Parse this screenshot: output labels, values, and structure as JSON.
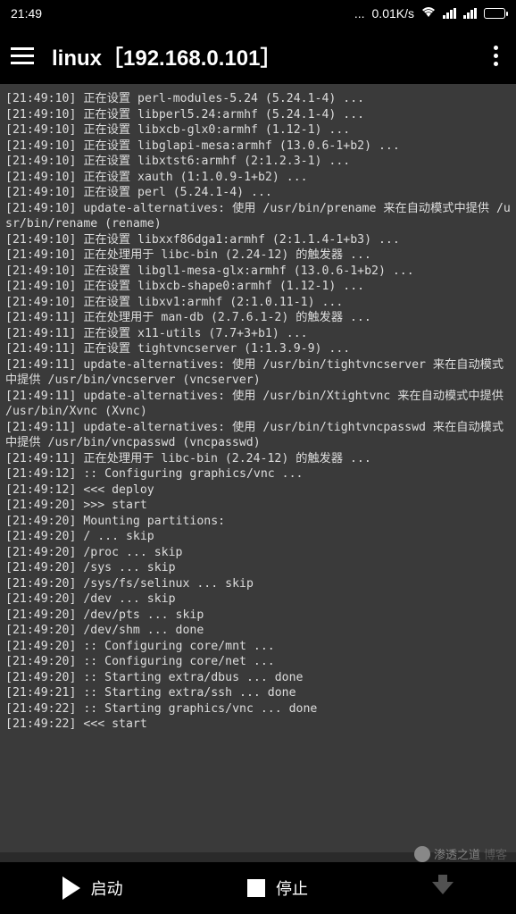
{
  "status": {
    "time": "21:49",
    "speed": "0.01K/s"
  },
  "header": {
    "title": "linux［192.168.0.101］"
  },
  "terminal": {
    "lines": [
      "[21:49:10] 正在设置 perl-modules-5.24 (5.24.1-4) ...",
      "[21:49:10] 正在设置 libperl5.24:armhf (5.24.1-4) ...",
      "[21:49:10] 正在设置 libxcb-glx0:armhf (1.12-1) ...",
      "[21:49:10] 正在设置 libglapi-mesa:armhf (13.0.6-1+b2) ...",
      "[21:49:10] 正在设置 libxtst6:armhf (2:1.2.3-1) ...",
      "[21:49:10] 正在设置 xauth (1:1.0.9-1+b2) ...",
      "[21:49:10] 正在设置 perl (5.24.1-4) ...",
      "[21:49:10] update-alternatives: 使用 /usr/bin/prename 来在自动模式中提供 /usr/bin/rename (rename)",
      "[21:49:10] 正在设置 libxxf86dga1:armhf (2:1.1.4-1+b3) ...",
      "[21:49:10] 正在处理用于 libc-bin (2.24-12) 的触发器 ...",
      "[21:49:10] 正在设置 libgl1-mesa-glx:armhf (13.0.6-1+b2) ...",
      "[21:49:10] 正在设置 libxcb-shape0:armhf (1.12-1) ...",
      "[21:49:10] 正在设置 libxv1:armhf (2:1.0.11-1) ...",
      "[21:49:11] 正在处理用于 man-db (2.7.6.1-2) 的触发器 ...",
      "[21:49:11] 正在设置 x11-utils (7.7+3+b1) ...",
      "[21:49:11] 正在设置 tightvncserver (1:1.3.9-9) ...",
      "[21:49:11] update-alternatives: 使用 /usr/bin/tightvncserver 来在自动模式中提供 /usr/bin/vncserver (vncserver)",
      "[21:49:11] update-alternatives: 使用 /usr/bin/Xtightvnc 来在自动模式中提供 /usr/bin/Xvnc (Xvnc)",
      "[21:49:11] update-alternatives: 使用 /usr/bin/tightvncpasswd 来在自动模式中提供 /usr/bin/vncpasswd (vncpasswd)",
      "[21:49:11] 正在处理用于 libc-bin (2.24-12) 的触发器 ...",
      "[21:49:12] :: Configuring graphics/vnc ...",
      "[21:49:12] <<< deploy",
      "[21:49:20] >>> start",
      "[21:49:20] Mounting partitions:",
      "[21:49:20] / ... skip",
      "[21:49:20] /proc ... skip",
      "[21:49:20] /sys ... skip",
      "[21:49:20] /sys/fs/selinux ... skip",
      "[21:49:20] /dev ... skip",
      "[21:49:20] /dev/pts ... skip",
      "[21:49:20] /dev/shm ... done",
      "[21:49:20] :: Configuring core/mnt ...",
      "[21:49:20] :: Configuring core/net ...",
      "[21:49:20] :: Starting extra/dbus ... done",
      "[21:49:21] :: Starting extra/ssh ... done",
      "[21:49:22] :: Starting graphics/vnc ... done",
      "[21:49:22] <<< start"
    ]
  },
  "bottom": {
    "start": "启动",
    "stop": "停止"
  },
  "watermark": {
    "text1": "渗透之道",
    "text2": "博客"
  }
}
